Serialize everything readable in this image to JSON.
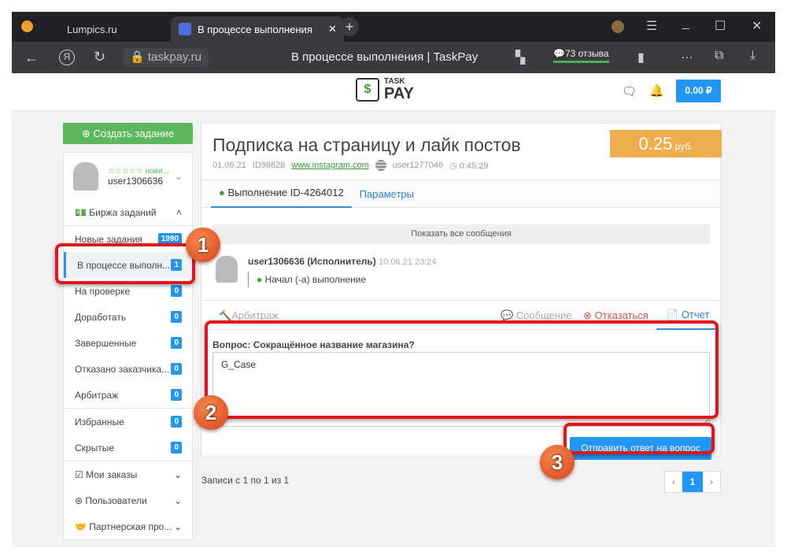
{
  "browser": {
    "tabs": [
      {
        "label": "Lumpics.ru"
      },
      {
        "label": "В процессе выполнения"
      }
    ],
    "url": "taskpay.ru",
    "page_title": "В процессе выполнения | TaskPay",
    "reviews": "73 отзыва"
  },
  "header": {
    "logo_top": "TASK",
    "logo_bottom": "PAY",
    "balance": "0.00 ₽"
  },
  "sidebar": {
    "create_label": "Создать задание",
    "user": {
      "rank": "☆☆☆☆☆ нови...",
      "name": "user1306636"
    },
    "exchange_label": "Биржа заданий",
    "items": [
      {
        "label": "Новые задания",
        "count": "1990"
      },
      {
        "label": "В процессе выполн...",
        "count": "1"
      },
      {
        "label": "На проверке",
        "count": "0"
      },
      {
        "label": "Доработать",
        "count": "0"
      },
      {
        "label": "Завершенные",
        "count": "0"
      },
      {
        "label": "Отказано заказчика...",
        "count": "0"
      },
      {
        "label": "Арбитраж",
        "count": "0"
      }
    ],
    "items2": [
      {
        "label": "Избранные",
        "count": "0"
      },
      {
        "label": "Скрытые",
        "count": "0"
      }
    ],
    "sections": [
      {
        "label": "Мои заказы"
      },
      {
        "label": "Пользователи"
      },
      {
        "label": "Партнерская про..."
      }
    ]
  },
  "task": {
    "title": "Подписка на страницу и лайк постов",
    "price": "0.25",
    "currency": "руб.",
    "date": "01.06.21",
    "id": "ID98828",
    "site": "www.instagram.com",
    "author": "user1277046",
    "timer": "0:45:29",
    "tabs": [
      {
        "label": "Выполнение ID-4264012"
      },
      {
        "label": "Параметры"
      }
    ],
    "show_all": "Показать все сообщения",
    "message": {
      "author": "user1306636 (Исполнитель)",
      "time": "10.06.21 23:24",
      "text": "Начал (-а) выполнение"
    },
    "actions": {
      "arbitrage": "Арбитраж",
      "message": "Сообщение",
      "refuse": "Отказаться",
      "report": "Отчет"
    },
    "question": "Вопрос: Сокращённое название магазина?",
    "answer": "G_Case",
    "submit": "Отправить ответ на вопрос"
  },
  "pagination": {
    "summary": "Записи с 1 по 1 из 1",
    "prev": "‹",
    "current": "1",
    "next": "›"
  },
  "annotations": [
    "1",
    "2",
    "3"
  ]
}
